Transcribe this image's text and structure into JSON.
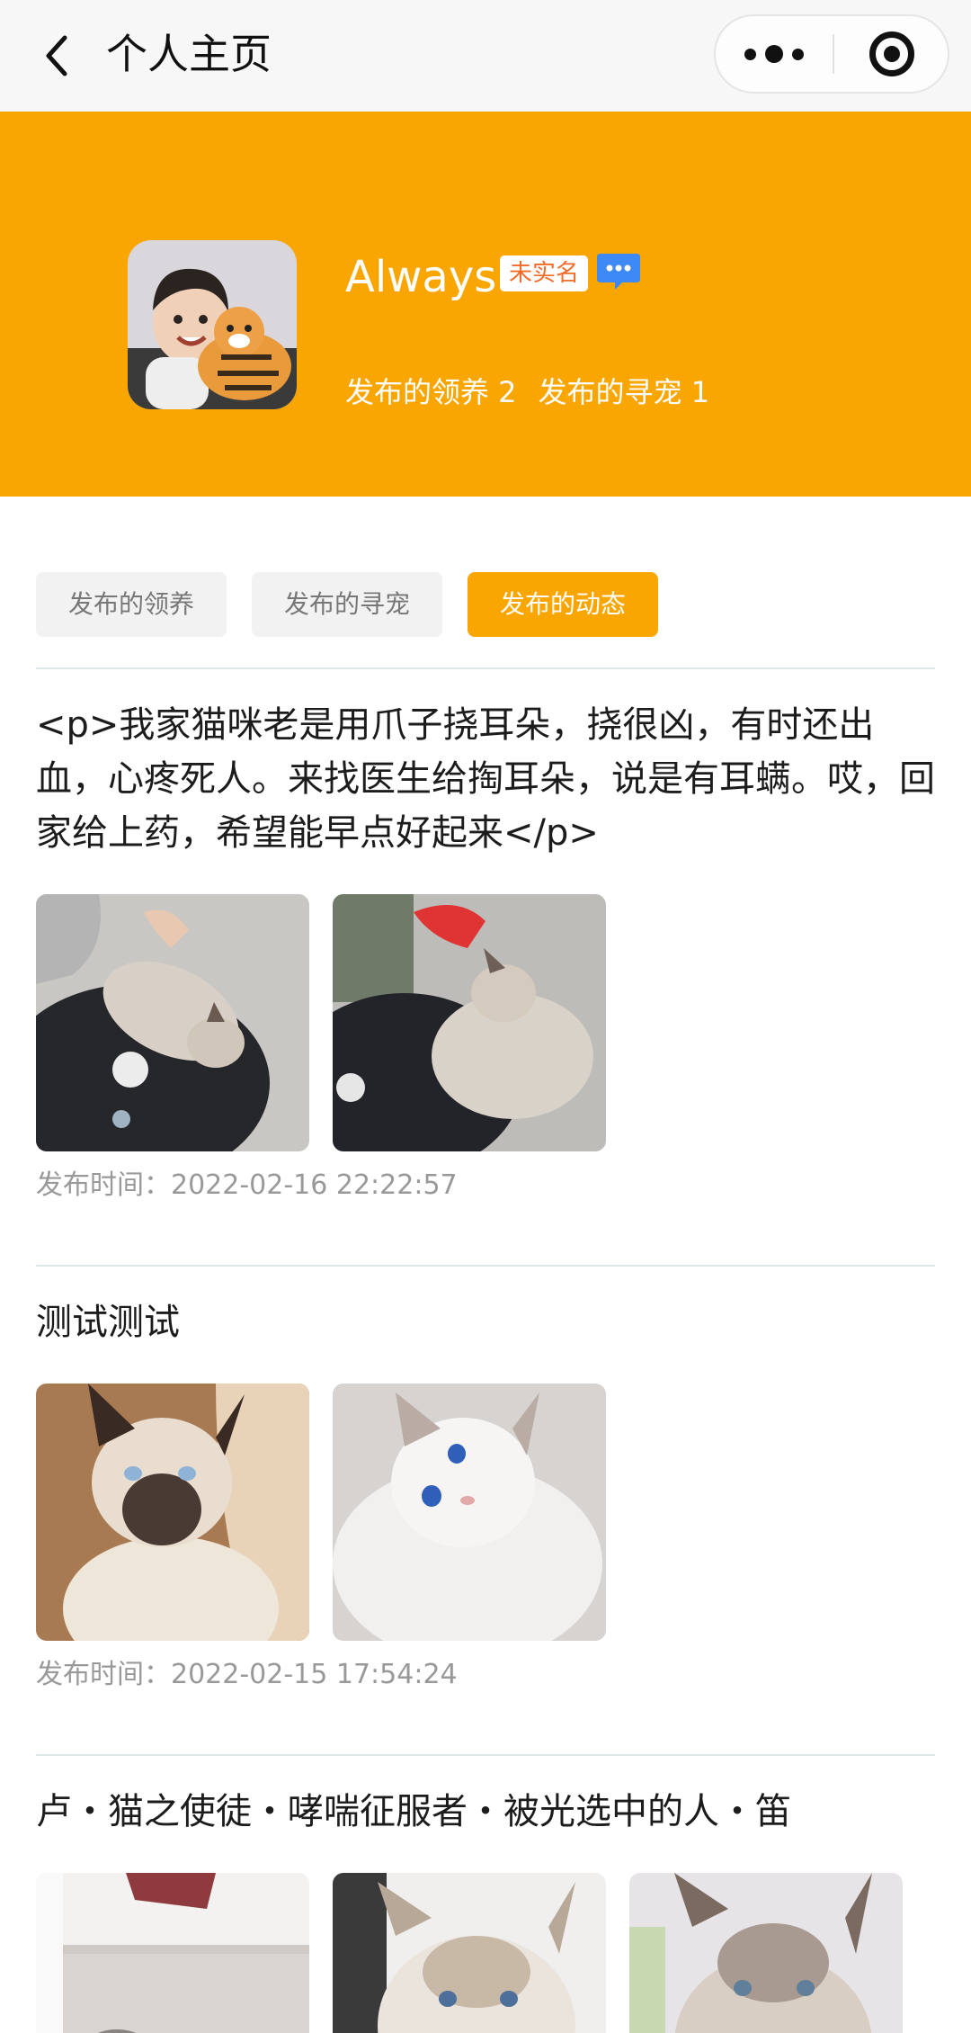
{
  "navbar": {
    "title": "个人主页"
  },
  "profile": {
    "username": "Always",
    "verify_badge": "未实名",
    "stats": [
      {
        "label": "发布的领养 2"
      },
      {
        "label": "发布的寻宠 1"
      }
    ]
  },
  "tabs": [
    {
      "label": "发布的领养",
      "active": false
    },
    {
      "label": "发布的寻宠",
      "active": false
    },
    {
      "label": "发布的动态",
      "active": true
    }
  ],
  "posts": [
    {
      "text": "<p>我家猫咪老是用爪子挠耳朵，挠很凶，有时还出血，心疼死人。来找医生给掏耳朵，说是有耳螨。哎，回家给上药，希望能早点好起来</p>",
      "image_count": 2,
      "time": "发布时间：2022-02-16 22:22:57"
    },
    {
      "text": "测试测试",
      "image_count": 2,
      "time": "发布时间：2022-02-15 17:54:24"
    },
    {
      "text": "卢・猫之使徒・哮喘征服者・被光选中的人・笛",
      "image_count": 3
    }
  ],
  "colors": {
    "accent": "#f9a602",
    "badge_text": "#f26b2a",
    "chat_icon": "#3d8af7"
  }
}
